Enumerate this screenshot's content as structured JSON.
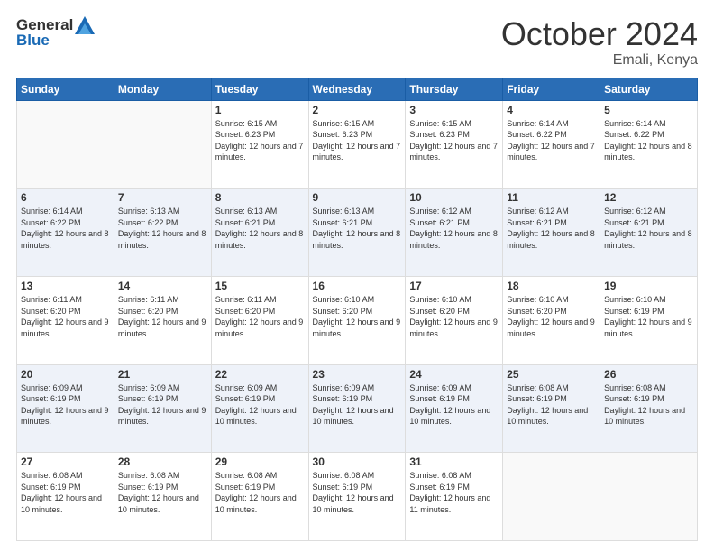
{
  "header": {
    "logo_general": "General",
    "logo_blue": "Blue",
    "month": "October 2024",
    "location": "Emali, Kenya"
  },
  "weekdays": [
    "Sunday",
    "Monday",
    "Tuesday",
    "Wednesday",
    "Thursday",
    "Friday",
    "Saturday"
  ],
  "weeks": [
    [
      {
        "day": "",
        "sunrise": "",
        "sunset": "",
        "daylight": ""
      },
      {
        "day": "",
        "sunrise": "",
        "sunset": "",
        "daylight": ""
      },
      {
        "day": "1",
        "sunrise": "Sunrise: 6:15 AM",
        "sunset": "Sunset: 6:23 PM",
        "daylight": "Daylight: 12 hours and 7 minutes."
      },
      {
        "day": "2",
        "sunrise": "Sunrise: 6:15 AM",
        "sunset": "Sunset: 6:23 PM",
        "daylight": "Daylight: 12 hours and 7 minutes."
      },
      {
        "day": "3",
        "sunrise": "Sunrise: 6:15 AM",
        "sunset": "Sunset: 6:23 PM",
        "daylight": "Daylight: 12 hours and 7 minutes."
      },
      {
        "day": "4",
        "sunrise": "Sunrise: 6:14 AM",
        "sunset": "Sunset: 6:22 PM",
        "daylight": "Daylight: 12 hours and 7 minutes."
      },
      {
        "day": "5",
        "sunrise": "Sunrise: 6:14 AM",
        "sunset": "Sunset: 6:22 PM",
        "daylight": "Daylight: 12 hours and 8 minutes."
      }
    ],
    [
      {
        "day": "6",
        "sunrise": "Sunrise: 6:14 AM",
        "sunset": "Sunset: 6:22 PM",
        "daylight": "Daylight: 12 hours and 8 minutes."
      },
      {
        "day": "7",
        "sunrise": "Sunrise: 6:13 AM",
        "sunset": "Sunset: 6:22 PM",
        "daylight": "Daylight: 12 hours and 8 minutes."
      },
      {
        "day": "8",
        "sunrise": "Sunrise: 6:13 AM",
        "sunset": "Sunset: 6:21 PM",
        "daylight": "Daylight: 12 hours and 8 minutes."
      },
      {
        "day": "9",
        "sunrise": "Sunrise: 6:13 AM",
        "sunset": "Sunset: 6:21 PM",
        "daylight": "Daylight: 12 hours and 8 minutes."
      },
      {
        "day": "10",
        "sunrise": "Sunrise: 6:12 AM",
        "sunset": "Sunset: 6:21 PM",
        "daylight": "Daylight: 12 hours and 8 minutes."
      },
      {
        "day": "11",
        "sunrise": "Sunrise: 6:12 AM",
        "sunset": "Sunset: 6:21 PM",
        "daylight": "Daylight: 12 hours and 8 minutes."
      },
      {
        "day": "12",
        "sunrise": "Sunrise: 6:12 AM",
        "sunset": "Sunset: 6:21 PM",
        "daylight": "Daylight: 12 hours and 8 minutes."
      }
    ],
    [
      {
        "day": "13",
        "sunrise": "Sunrise: 6:11 AM",
        "sunset": "Sunset: 6:20 PM",
        "daylight": "Daylight: 12 hours and 9 minutes."
      },
      {
        "day": "14",
        "sunrise": "Sunrise: 6:11 AM",
        "sunset": "Sunset: 6:20 PM",
        "daylight": "Daylight: 12 hours and 9 minutes."
      },
      {
        "day": "15",
        "sunrise": "Sunrise: 6:11 AM",
        "sunset": "Sunset: 6:20 PM",
        "daylight": "Daylight: 12 hours and 9 minutes."
      },
      {
        "day": "16",
        "sunrise": "Sunrise: 6:10 AM",
        "sunset": "Sunset: 6:20 PM",
        "daylight": "Daylight: 12 hours and 9 minutes."
      },
      {
        "day": "17",
        "sunrise": "Sunrise: 6:10 AM",
        "sunset": "Sunset: 6:20 PM",
        "daylight": "Daylight: 12 hours and 9 minutes."
      },
      {
        "day": "18",
        "sunrise": "Sunrise: 6:10 AM",
        "sunset": "Sunset: 6:20 PM",
        "daylight": "Daylight: 12 hours and 9 minutes."
      },
      {
        "day": "19",
        "sunrise": "Sunrise: 6:10 AM",
        "sunset": "Sunset: 6:19 PM",
        "daylight": "Daylight: 12 hours and 9 minutes."
      }
    ],
    [
      {
        "day": "20",
        "sunrise": "Sunrise: 6:09 AM",
        "sunset": "Sunset: 6:19 PM",
        "daylight": "Daylight: 12 hours and 9 minutes."
      },
      {
        "day": "21",
        "sunrise": "Sunrise: 6:09 AM",
        "sunset": "Sunset: 6:19 PM",
        "daylight": "Daylight: 12 hours and 9 minutes."
      },
      {
        "day": "22",
        "sunrise": "Sunrise: 6:09 AM",
        "sunset": "Sunset: 6:19 PM",
        "daylight": "Daylight: 12 hours and 10 minutes."
      },
      {
        "day": "23",
        "sunrise": "Sunrise: 6:09 AM",
        "sunset": "Sunset: 6:19 PM",
        "daylight": "Daylight: 12 hours and 10 minutes."
      },
      {
        "day": "24",
        "sunrise": "Sunrise: 6:09 AM",
        "sunset": "Sunset: 6:19 PM",
        "daylight": "Daylight: 12 hours and 10 minutes."
      },
      {
        "day": "25",
        "sunrise": "Sunrise: 6:08 AM",
        "sunset": "Sunset: 6:19 PM",
        "daylight": "Daylight: 12 hours and 10 minutes."
      },
      {
        "day": "26",
        "sunrise": "Sunrise: 6:08 AM",
        "sunset": "Sunset: 6:19 PM",
        "daylight": "Daylight: 12 hours and 10 minutes."
      }
    ],
    [
      {
        "day": "27",
        "sunrise": "Sunrise: 6:08 AM",
        "sunset": "Sunset: 6:19 PM",
        "daylight": "Daylight: 12 hours and 10 minutes."
      },
      {
        "day": "28",
        "sunrise": "Sunrise: 6:08 AM",
        "sunset": "Sunset: 6:19 PM",
        "daylight": "Daylight: 12 hours and 10 minutes."
      },
      {
        "day": "29",
        "sunrise": "Sunrise: 6:08 AM",
        "sunset": "Sunset: 6:19 PM",
        "daylight": "Daylight: 12 hours and 10 minutes."
      },
      {
        "day": "30",
        "sunrise": "Sunrise: 6:08 AM",
        "sunset": "Sunset: 6:19 PM",
        "daylight": "Daylight: 12 hours and 10 minutes."
      },
      {
        "day": "31",
        "sunrise": "Sunrise: 6:08 AM",
        "sunset": "Sunset: 6:19 PM",
        "daylight": "Daylight: 12 hours and 11 minutes."
      },
      {
        "day": "",
        "sunrise": "",
        "sunset": "",
        "daylight": ""
      },
      {
        "day": "",
        "sunrise": "",
        "sunset": "",
        "daylight": ""
      }
    ]
  ]
}
